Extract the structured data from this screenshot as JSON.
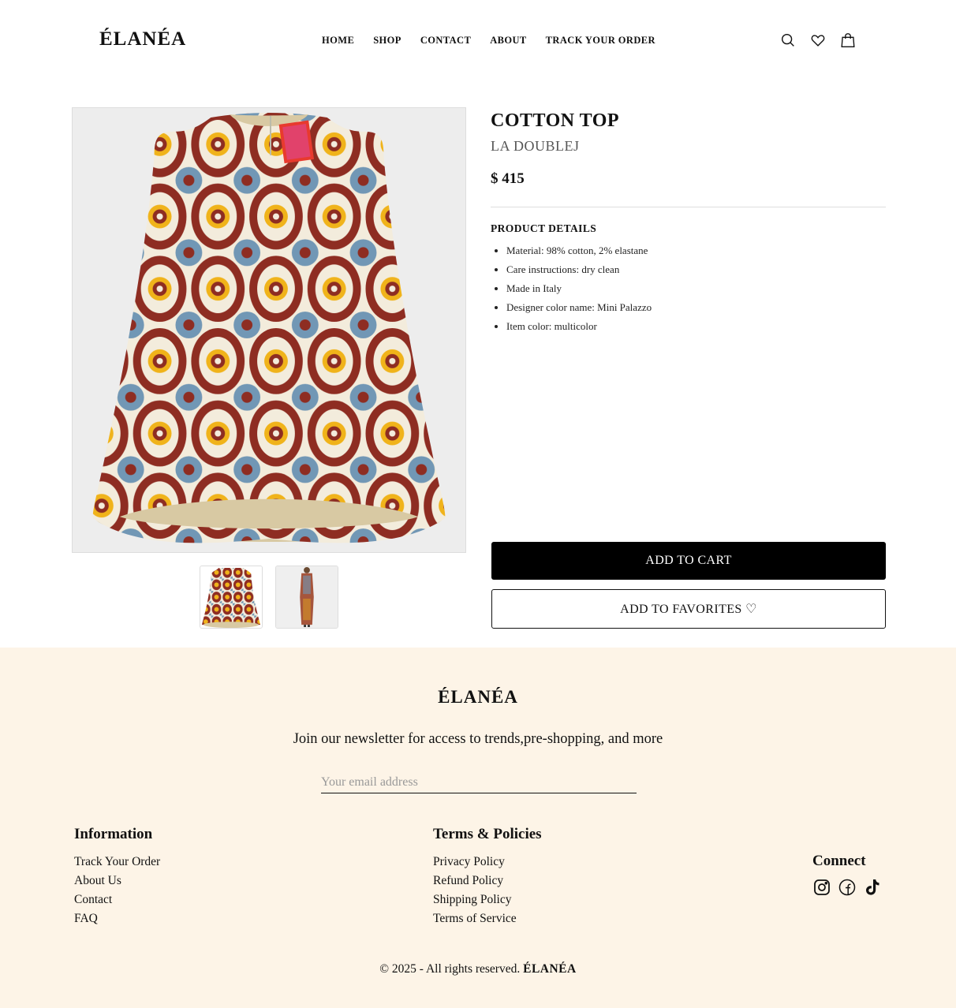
{
  "header": {
    "logo": "ÉLANÉA",
    "nav": [
      "HOME",
      "SHOP",
      "CONTACT",
      "ABOUT",
      "TRACK YOUR ORDER"
    ],
    "icons": [
      "search-icon",
      "heart-icon",
      "shopping-bag-icon"
    ]
  },
  "product": {
    "title": "COTTON TOP",
    "brand": "LA DOUBLEJ",
    "price": "$ 415",
    "details_heading": "PRODUCT DETAILS",
    "details": [
      "Material: 98% cotton, 2% elastane",
      "Care instructions: dry clean",
      "Made in Italy",
      "Designer color name: Mini Palazzo",
      "Item color: multicolor"
    ],
    "add_to_cart": "ADD TO CART",
    "add_to_favorites": "ADD TO FAVORITES ♡",
    "image_colors": {
      "background": "#ededed",
      "pattern_red": "#8e2d22",
      "pattern_blue": "#7197b5",
      "pattern_yellow": "#f0b31a",
      "lining": "#d8c9a3"
    }
  },
  "footer": {
    "logo": "ÉLANÉA",
    "newsletter_text": "Join our newsletter for access to trends,pre-shopping, and more",
    "email_placeholder": "Your email address",
    "information": {
      "heading": "Information",
      "links": [
        "Track Your Order",
        "About Us",
        "Contact",
        "FAQ"
      ]
    },
    "terms": {
      "heading": "Terms & Policies",
      "links": [
        "Privacy Policy",
        "Refund Policy",
        "Shipping Policy",
        "Terms of Service"
      ]
    },
    "connect": {
      "heading": "Connect",
      "icons": [
        "instagram-icon",
        "facebook-icon",
        "tiktok-icon"
      ]
    },
    "copyright_prefix": "© 2025 - All rights reserved.",
    "copyright_brand": "ÉLANÉA",
    "background": "#fdf4e7"
  }
}
